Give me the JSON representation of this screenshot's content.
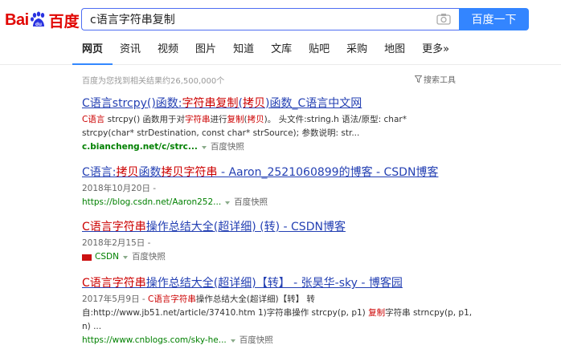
{
  "logo": {
    "text_left": "Bai",
    "text_right": "百度",
    "paw_label": "du"
  },
  "search": {
    "query": "c语言字符串复制",
    "button_label": "百度一下"
  },
  "tabs": [
    "网页",
    "资讯",
    "视频",
    "图片",
    "知道",
    "文库",
    "贴吧",
    "采购",
    "地图",
    "更多»"
  ],
  "result_count": "百度为您找到相关结果约26,500,000个",
  "tools_label": "搜索工具",
  "results": [
    {
      "title_parts": [
        "C语言strcpy()函数:",
        "字符串复制",
        "(",
        "拷贝",
        ")函数_C语言中文网"
      ],
      "abstract_line1": [
        "C语言",
        " strcpy() 函数用于对",
        "字符串",
        "进行",
        "复制",
        "(",
        "拷贝",
        ")。 头文件:string.h 语法/原型: char*"
      ],
      "abstract_line2": "strcpy(char* strDestination, const char* strSource); 参数说明: str...",
      "url": "c.biancheng.net/c/strc...",
      "snapshot": "百度快照"
    },
    {
      "title_parts": [
        "C语言:",
        "拷贝",
        "函数",
        "拷贝字符串",
        " - Aaron_2521060899的博客 - CSDN博客"
      ],
      "date": "2018年10月20日 -",
      "url": "https://blog.csdn.net/Aaron252...",
      "snapshot": "百度快照"
    },
    {
      "title_parts": [
        "C语言字符串",
        "操作总结大全(超详细) (转) - CSDN博客"
      ],
      "date": "2018年2月15日 -",
      "url": "CSDN",
      "snapshot": "百度快照"
    },
    {
      "title_parts": [
        "C语言字符串",
        "操作总结大全(超详细)【转】 - 张昊华-sky - 博客园"
      ],
      "date_line": [
        "2017年5月9日 - ",
        "C语言字符串",
        "操作总结大全(超详细)【转】 转"
      ],
      "abstract_line2": [
        "自:http://www.jb51.net/article/37410.htm 1)字符串操作 strcpy(p, p1) ",
        "复制",
        "字符串 strncpy(p, p1,"
      ],
      "abstract_line3": "n) ...",
      "url": "https://www.cnblogs.com/sky-he...",
      "snapshot": "百度快照"
    }
  ],
  "colors": {
    "brand_red": "#e10602",
    "link_blue": "#2440b3",
    "highlight_red": "#cc0000",
    "url_green": "#008000",
    "button_blue": "#3385ff"
  }
}
